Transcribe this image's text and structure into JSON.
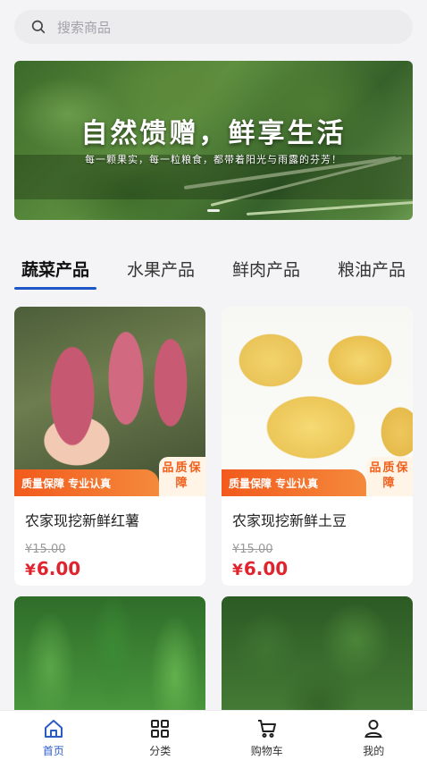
{
  "search": {
    "placeholder": "搜索商品"
  },
  "banner": {
    "title": "自然馈赠，鲜享生活",
    "subtitle": "每一颗果实，每一粒粮食，都带着阳光与雨露的芬芳！"
  },
  "tabs": [
    {
      "label": "蔬菜产品",
      "active": true
    },
    {
      "label": "水果产品",
      "active": false
    },
    {
      "label": "鲜肉产品",
      "active": false
    },
    {
      "label": "粮油产品",
      "active": false
    }
  ],
  "products": [
    {
      "name": "农家现挖新鲜红薯",
      "old_price": "¥15.00",
      "currency": "¥",
      "price": "6.00",
      "strip_left": "质量保障 专业认真",
      "strip_right": "品质保障"
    },
    {
      "name": "农家现挖新鲜土豆",
      "old_price": "¥15.00",
      "currency": "¥",
      "price": "6.00",
      "strip_left": "质量保障 专业认真",
      "strip_right": "品质保障"
    }
  ],
  "nav": [
    {
      "label": "首页",
      "icon": "home-icon",
      "active": true
    },
    {
      "label": "分类",
      "icon": "grid-icon",
      "active": false
    },
    {
      "label": "购物车",
      "icon": "cart-icon",
      "active": false
    },
    {
      "label": "我的",
      "icon": "user-icon",
      "active": false
    }
  ],
  "colors": {
    "accent": "#1f56c7",
    "price": "#e0242e",
    "badge_orange": "#f25a1c"
  }
}
